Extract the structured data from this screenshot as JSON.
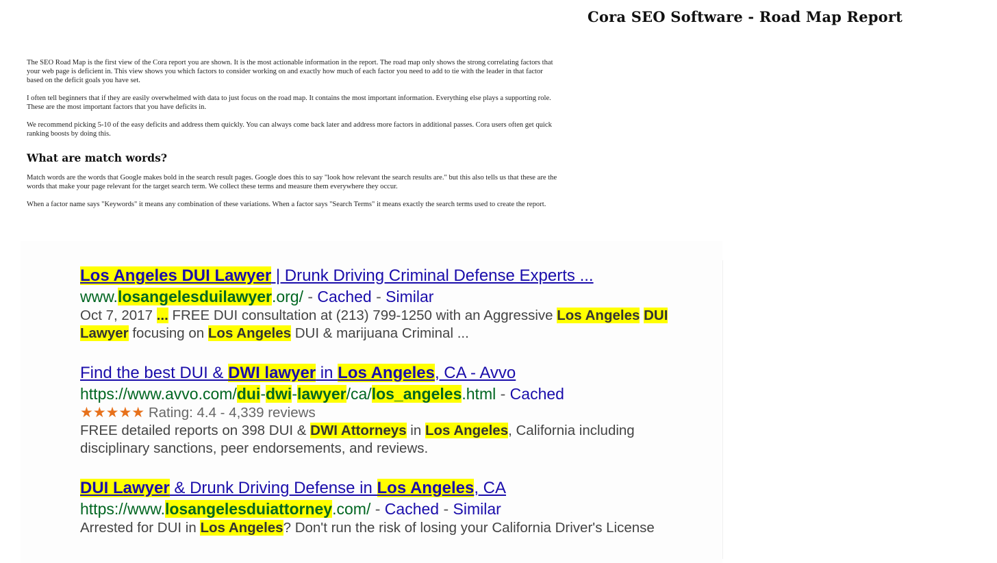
{
  "header": {
    "title": "Cora SEO Software - Road Map Report"
  },
  "intro": {
    "paragraphs": [
      "The SEO Road Map is the first view of the Cora report you are shown. It is the most actionable information in the report. The road map only shows the strong correlating factors that your web page is deficient in. This view shows you which factors to consider working on and exactly how much of each factor you need to add to tie with the leader in that factor based on the deficit goals you have set.",
      "I often tell beginners that if they are easily overwhelmed with data to just focus on the road map. It contains the most important information. Everything else plays a supporting role. These are the most important factors that you have deficits in.",
      "We recommend picking 5-10 of the easy deficits and address them quickly. You can always come back later and address more factors in additional passes. Cora users often get quick ranking boosts by doing this."
    ],
    "heading": "What are match words?",
    "match_paragraphs": [
      "Match words are the words that Google makes bold in the search result pages. Google does this to say \"look how relevant the search results are.\" but this also tells us that these are the words that make your page relevant for the target search term. We collect these terms and measure them everywhere they occur.",
      "When a factor name says \"Keywords\" it means any combination of these variations. When a factor says \"Search Terms\" it means exactly the search terms used to create the report."
    ]
  },
  "serp": {
    "r1": {
      "title_hl1": "Los Angeles DUI Lawyer",
      "title_rest": " | Drunk Driving Criminal Defense Experts ...",
      "url_pre": "www.",
      "url_hl": "losangelesduilawyer",
      "url_post": ".org/",
      "sep1": " - ",
      "cached": "Cached",
      "sep2": " - ",
      "similar": "Similar",
      "date": "Oct 7, 2017 ",
      "ellipsis_hl": "...",
      "snip1": " FREE DUI consultation at (213) 799-1250 with an Aggressive ",
      "snip_hl1": "Los Angeles",
      "snip2": " ",
      "snip_hl2": "DUI",
      "snip3": " ",
      "snip_hl3": "Lawyer",
      "snip4": " focusing on ",
      "snip_hl4": "Los Angeles",
      "snip5": " DUI & marijuana Criminal ..."
    },
    "r2": {
      "t1": "Find the best DUI & ",
      "t_hl1": "DWI lawyer",
      "t2": " in ",
      "t_hl2": "Los Angeles",
      "t3": ", CA - Avvo",
      "u1": "https://www.avvo.com/",
      "u_hl1": "dui",
      "u2": "-",
      "u_hl2": "dwi",
      "u3": "-",
      "u_hl3": "lawyer",
      "u4": "/ca/",
      "u_hl4": "los_angeles",
      "u5": ".html",
      "sep": " - ",
      "cached": "Cached",
      "stars": "★★★★★",
      "rating": "Rating: 4.4 - 4,339 reviews",
      "rating_value": 4.4,
      "s1": "FREE detailed reports on 398 DUI & ",
      "s_hl1": "DWI Attorneys",
      "s2": " in ",
      "s_hl2": "Los Angeles",
      "s3": ", California including disciplinary sanctions, peer endorsements, and reviews."
    },
    "r3": {
      "t_hl1": "DUI Lawyer",
      "t1": " & Drunk Driving Defense in ",
      "t_hl2": "Los Angeles",
      "t2": ", CA",
      "u1": "https://www.",
      "u_hl": "losangelesduiattorney",
      "u2": ".com/",
      "sep1": " - ",
      "cached": "Cached",
      "sep2": " - ",
      "similar": "Similar",
      "s1": "Arrested for DUI in ",
      "s_hl1": "Los Angeles",
      "s2": "? Don't run the risk of losing your California Driver's License"
    }
  },
  "colors": {
    "link": "#1a0dab",
    "url": "#006621",
    "highlight": "#ffff00",
    "stars": "#e7711b"
  }
}
